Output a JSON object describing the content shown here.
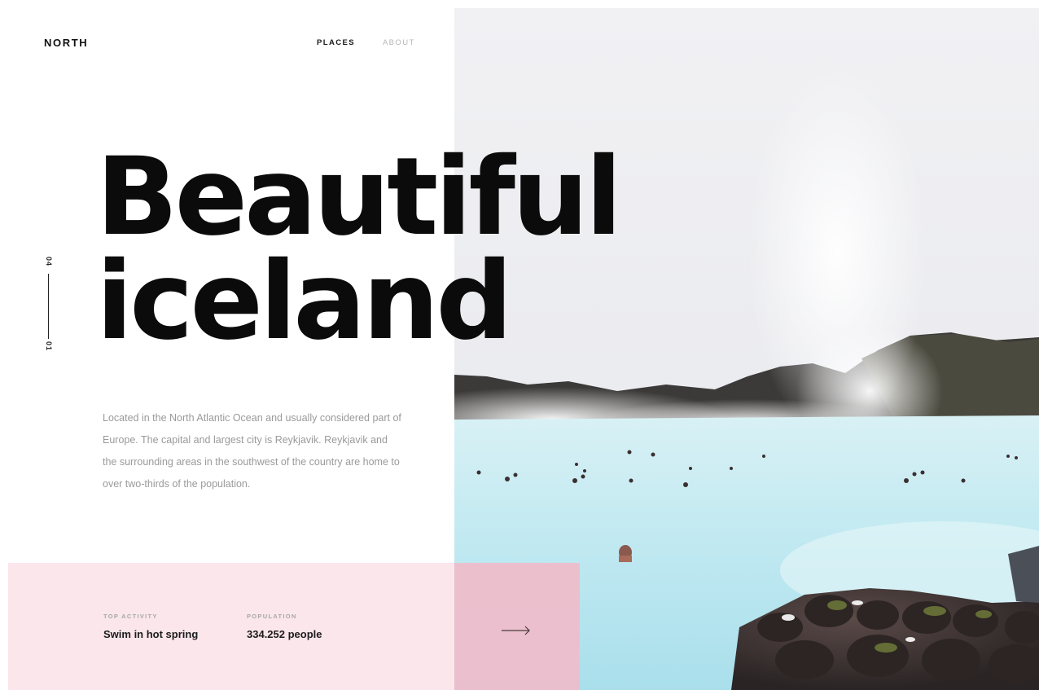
{
  "brand": {
    "name": "NORTH"
  },
  "nav": {
    "items": [
      {
        "label": "PLACES",
        "active": true
      },
      {
        "label": "ABOUT",
        "active": false
      }
    ]
  },
  "slide": {
    "current": "01",
    "total": "04"
  },
  "hero": {
    "line1": "Beautiful",
    "line2": "iceland",
    "description": "Located in the North Atlantic Ocean and usually considered part of Europe. The capital and largest city is Reykjavik. Reykjavik and the surrounding areas in the southwest of the country are home to over two-thirds of the population."
  },
  "stats": {
    "activity": {
      "label": "TOP ACTIVITY",
      "value": "Swim in hot spring"
    },
    "population": {
      "label": "POPULATION",
      "value": "334.252 people"
    }
  },
  "icons": {
    "next": "arrow-right-icon"
  },
  "colors": {
    "band": "#fbe6ec",
    "band_accent": "#f0bcca",
    "text_dark": "#0b0b0b",
    "text_muted": "#9a9a9a",
    "lagoon": "#c9edf3"
  }
}
